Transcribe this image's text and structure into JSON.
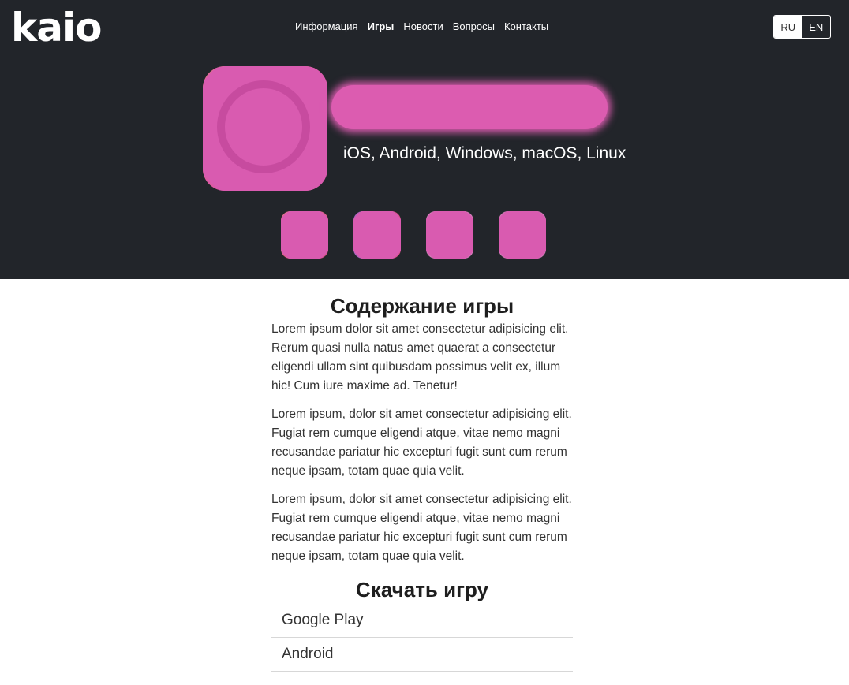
{
  "header": {
    "logo": "kaio",
    "nav": [
      {
        "label": "Информация",
        "active": false
      },
      {
        "label": "Игры",
        "active": true
      },
      {
        "label": "Новости",
        "active": false
      },
      {
        "label": "Вопросы",
        "active": false
      },
      {
        "label": "Контакты",
        "active": false
      }
    ],
    "lang": {
      "ru": "RU",
      "en": "EN",
      "selected": "RU"
    }
  },
  "game": {
    "platforms": "iOS, Android, Windows, macOS, Linux",
    "store_icons": [
      "store-icon-1",
      "store-icon-2",
      "store-icon-3",
      "store-icon-4"
    ]
  },
  "content": {
    "heading": "Содержание игры",
    "paragraphs": [
      "Lorem ipsum dolor sit amet consectetur adipisicing elit. Rerum quasi nulla natus amet quaerat a consectetur eligendi ullam sint quibusdam possimus velit ex, illum hic! Cum iure maxime ad. Tenetur!",
      "Lorem ipsum, dolor sit amet consectetur adipisicing elit. Fugiat rem cumque eligendi atque, vitae nemo magni recusandae pariatur hic excepturi fugit sunt cum rerum neque ipsam, totam quae quia velit.",
      "Lorem ipsum, dolor sit amet consectetur adipisicing elit. Fugiat rem cumque eligendi atque, vitae nemo magni recusandae pariatur hic excepturi fugit sunt cum rerum neque ipsam, totam quae quia velit."
    ],
    "download_heading": "Скачать игру",
    "downloads": [
      "Google Play",
      "Android"
    ]
  }
}
